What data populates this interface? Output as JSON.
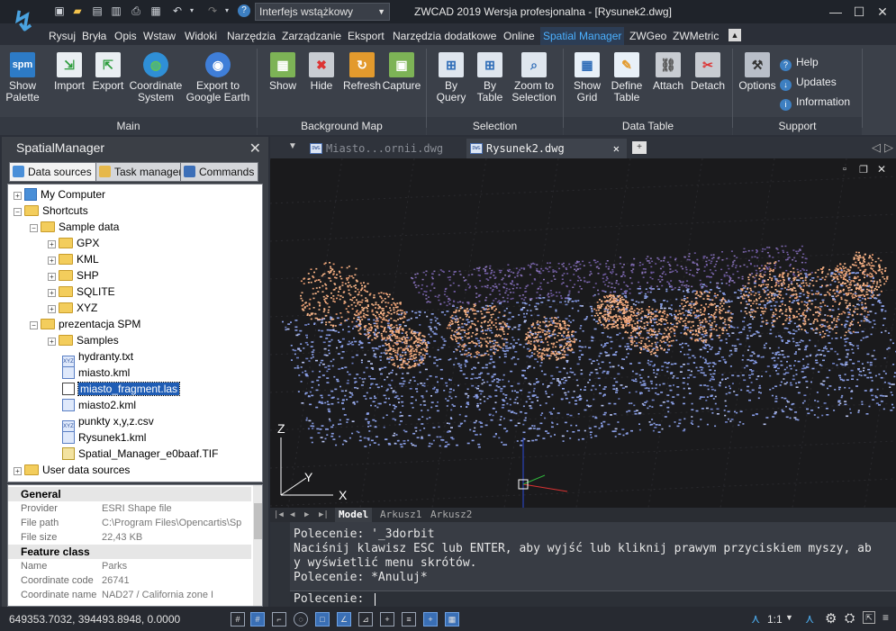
{
  "titlebar": {
    "app_title": "ZWCAD 2019 Wersja profesjonalna - [Rysunek2.dwg]",
    "workspace": "Interfejs wstążkowy",
    "minimize": "—",
    "maximize": "☐",
    "close": "✕"
  },
  "menu": [
    "Rysuj",
    "Bryła",
    "Opis",
    "Wstaw",
    "Widoki",
    "Narzędzia",
    "Zarządzanie",
    "Eksport",
    "Narzędzia dodatkowe",
    "Online",
    "Spatial Manager",
    "ZWGeo",
    "ZWMetric"
  ],
  "ribbon": {
    "main": {
      "label": "Main",
      "buttons": [
        {
          "l1": "Show",
          "l2": "Palette"
        },
        {
          "l1": "Import",
          "l2": ""
        },
        {
          "l1": "Export",
          "l2": ""
        },
        {
          "l1": "Coordinate",
          "l2": "System"
        },
        {
          "l1": "Export to",
          "l2": "Google Earth"
        }
      ]
    },
    "background": {
      "label": "Background Map",
      "buttons": [
        {
          "l1": "Show",
          "l2": ""
        },
        {
          "l1": "Hide",
          "l2": ""
        },
        {
          "l1": "Refresh",
          "l2": ""
        },
        {
          "l1": "Capture",
          "l2": ""
        }
      ]
    },
    "selection": {
      "label": "Selection",
      "buttons": [
        {
          "l1": "By",
          "l2": "Query"
        },
        {
          "l1": "By",
          "l2": "Table"
        },
        {
          "l1": "Zoom to",
          "l2": "Selection"
        }
      ]
    },
    "datatable": {
      "label": "Data Table",
      "buttons": [
        {
          "l1": "Show",
          "l2": "Grid"
        },
        {
          "l1": "Define",
          "l2": "Table"
        },
        {
          "l1": "Attach",
          "l2": ""
        },
        {
          "l1": "Detach",
          "l2": ""
        }
      ]
    },
    "support": {
      "label": "Support",
      "options": "Options",
      "help": "Help",
      "updates": "Updates",
      "information": "Information"
    }
  },
  "panel": {
    "title": "SpatialManager",
    "close": "✕",
    "tabs": [
      "Data sources",
      "Task manager",
      "Commands"
    ],
    "tree": [
      "My Computer",
      "Shortcuts",
      "Sample data",
      "GPX",
      "KML",
      "SHP",
      "SQLITE",
      "XYZ",
      "prezentacja SPM",
      "Samples",
      "hydranty.txt",
      "miasto.kml",
      "miasto_fragment.las",
      "miasto2.kml",
      "punkty x,y,z.csv",
      "Rysunek1.kml",
      "Spatial_Manager_e0baaf.TIF",
      "User data sources"
    ]
  },
  "props": {
    "general": "General",
    "provider_k": "Provider",
    "provider_v": "ESRI Shape file",
    "filepath_k": "File path",
    "filepath_v": "C:\\Program Files\\Opencartis\\Sp",
    "filesize_k": "File size",
    "filesize_v": "22,43 KB",
    "feature": "Feature class",
    "name_k": "Name",
    "name_v": "Parks",
    "cc_k": "Coordinate code",
    "cc_v": "26741",
    "cn_k": "Coordinate name",
    "cn_v": "NAD27 / California zone I"
  },
  "doctabs": [
    "Miasto...ornii.dwg",
    "Rysunek2.dwg"
  ],
  "layouts": [
    "Model",
    "Arkusz1",
    "Arkusz2"
  ],
  "axes": {
    "z": "Z",
    "y": "Y",
    "x": "X"
  },
  "command": {
    "l1": "Polecenie: '_3dorbit",
    "l2": "Naciśnij klawisz ESC lub ENTER, aby wyjść lub kliknij prawym przyciskiem myszy, ab",
    "l3": "y wyświetlić menu skrótów.",
    "l4": "Polecenie: *Anuluj*",
    "prompt": "Polecenie:"
  },
  "status": {
    "coords": "649353.7032, 394493.8948, 0.0000",
    "scale": "1:1"
  }
}
